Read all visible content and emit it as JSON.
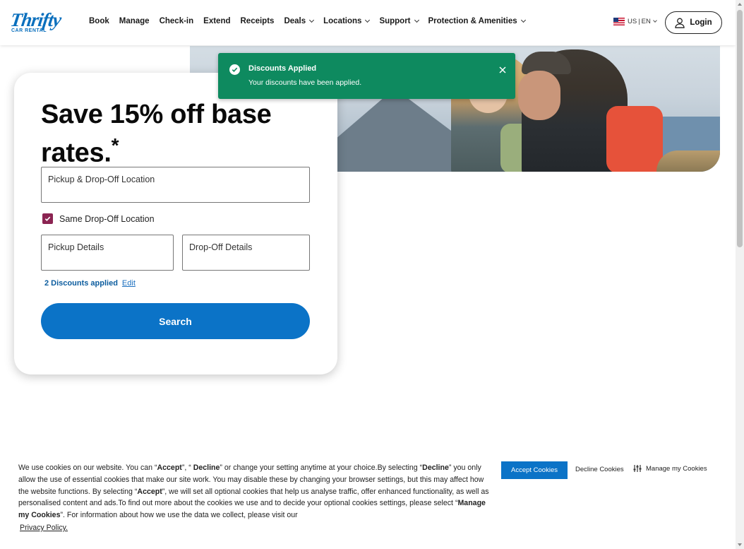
{
  "header": {
    "logo": {
      "brand": "Thrifty",
      "sub": "CAR RENTAL"
    },
    "nav": [
      {
        "label": "Book",
        "dropdown": false
      },
      {
        "label": "Manage",
        "dropdown": false
      },
      {
        "label": "Check-in",
        "dropdown": false
      },
      {
        "label": "Extend",
        "dropdown": false
      },
      {
        "label": "Receipts",
        "dropdown": false
      },
      {
        "label": "Deals",
        "dropdown": true
      },
      {
        "label": "Locations",
        "dropdown": true
      },
      {
        "label": "Support",
        "dropdown": true
      },
      {
        "label": "Protection & Amenities",
        "dropdown": true
      }
    ],
    "locale": {
      "country": "US",
      "language": "EN"
    },
    "login_label": "Login"
  },
  "toast": {
    "title": "Discounts Applied",
    "message": "Your discounts have been applied."
  },
  "booking": {
    "headline": "Save 15% off base rates.",
    "headline_mark": "*",
    "location_label": "Pickup & Drop-Off Location",
    "same_dropoff_label": "Same Drop-Off Location",
    "same_dropoff_checked": true,
    "pickup_label": "Pickup Details",
    "dropoff_label": "Drop-Off Details",
    "discounts_text": "2 Discounts applied",
    "edit_label": "Edit",
    "search_label": "Search"
  },
  "cookie": {
    "text_segments": [
      {
        "t": "We use cookies on our website. You can “",
        "b": false
      },
      {
        "t": "Accept",
        "b": true
      },
      {
        "t": "”, “ ",
        "b": false
      },
      {
        "t": "Decline",
        "b": true
      },
      {
        "t": "” or change your setting anytime at your choice.By selecting “",
        "b": false
      },
      {
        "t": "Decline",
        "b": true
      },
      {
        "t": "” you only allow the use of essential cookies that make our site work. You may disable these by changing your browser settings, but this may affect how the website functions. By selecting “",
        "b": false
      },
      {
        "t": "Accept",
        "b": true
      },
      {
        "t": "”, we will set all optional cookies that help us analyse traffic, offer enhanced functionality, as well as personalised content and ads.To find out more about the cookies we use and to decide your optional cookies settings, please select “",
        "b": false
      },
      {
        "t": "Manage my Cookies",
        "b": true
      },
      {
        "t": "”. For information about how we use the data we collect, please visit our",
        "b": false
      }
    ],
    "privacy_link": "Privacy Policy.",
    "accept_label": "Accept Cookies",
    "decline_label": "Decline Cookies",
    "manage_label": "Manage my Cookies"
  },
  "colors": {
    "accent_blue": "#0b73c7",
    "toast_green": "#0e8a5f",
    "checkbox_purple": "#8b2452"
  }
}
